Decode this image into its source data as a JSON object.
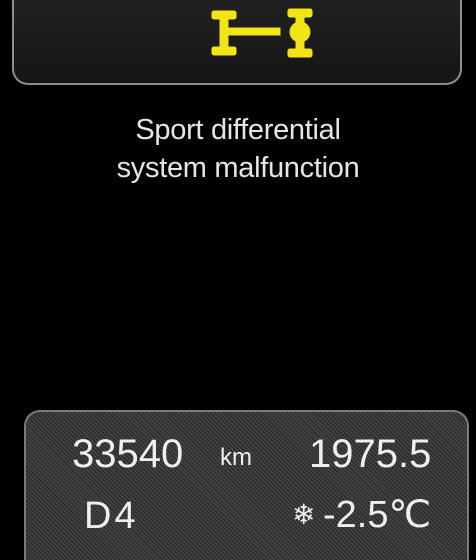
{
  "warning": {
    "icon": "sport-differential-icon",
    "icon_color": "#f2e415",
    "message_line1": "Sport differential",
    "message_line2": "system malfunction"
  },
  "info": {
    "odometer": "33540",
    "unit": "km",
    "trip": "1975.5",
    "gear": "D4",
    "snowflake_icon": "❄",
    "outside_temp": "-2.5℃"
  }
}
